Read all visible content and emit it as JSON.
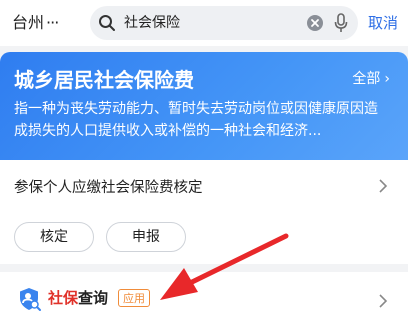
{
  "header": {
    "city": "台州",
    "city_more": "···",
    "search_value": "社会保险",
    "cancel_label": "取消"
  },
  "banner": {
    "title": "城乡居民社会保险费",
    "all_label": "全部",
    "all_chevron": "›",
    "description": "指一种为丧失劳动能力、暂时失去劳动岗位或因健康原因造成损失的人口提供收入或补偿的一种社会和经济..."
  },
  "service_row": {
    "label": "参保个人应缴社会保险费核定"
  },
  "actions": [
    {
      "label": "核定"
    },
    {
      "label": "申报"
    }
  ],
  "app_result": {
    "title_highlight": "社保",
    "title_rest": "查询",
    "badge": "应用"
  },
  "icons": {
    "search": "search-icon",
    "clear": "clear-icon",
    "mic": "microphone-icon",
    "chevron": "chevron-right-icon",
    "app": "social-security-query-icon",
    "annotation": "red-arrow-annotation"
  },
  "colors": {
    "accent": "#2f6fe6",
    "banner_start": "#2f7df0",
    "banner_end": "#5aa4fa",
    "highlight": "#e0322a",
    "badge": "#f08c3a",
    "arrow": "#e8282a"
  }
}
